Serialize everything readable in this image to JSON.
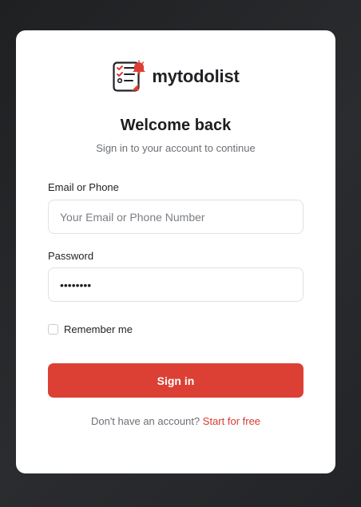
{
  "brand": {
    "name": "mytodolist",
    "logo_icon": "checklist-icon",
    "accent_color": "#dc4034"
  },
  "header": {
    "title": "Welcome back",
    "subtitle": "Sign in to your account to continue"
  },
  "form": {
    "email": {
      "label": "Email or Phone",
      "placeholder": "Your Email or Phone Number",
      "value": ""
    },
    "password": {
      "label": "Password",
      "value": "********"
    },
    "remember": {
      "label": "Remember me",
      "checked": false
    },
    "submit_label": "Sign in"
  },
  "footer": {
    "prompt": "Don't have an account? ",
    "link_label": "Start for free"
  }
}
